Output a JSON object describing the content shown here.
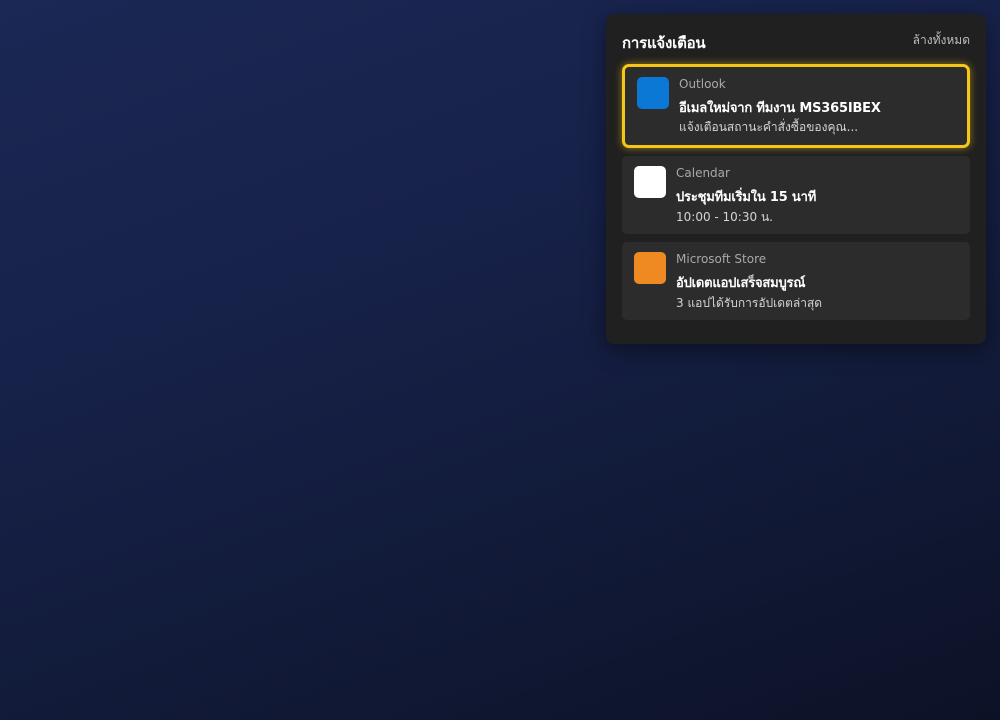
{
  "panel": {
    "title": "การแจ้งเตือน",
    "clear_all_label": "ล้างทั้งหมด"
  },
  "notifications": [
    {
      "app": "Outlook",
      "icon": "outlook-icon",
      "icon_color": "#0a78d4",
      "title": "อีเมลใหม่จาก ทีมงาน MS365IBEX",
      "body": "แจ้งเตือนสถานะคำสั่งซื้อของคุณ...",
      "focused": true
    },
    {
      "app": "Calendar",
      "icon": "calendar-icon",
      "icon_color": "#ffffff",
      "title": "ประชุมทีมเริ่มใน 15 นาที",
      "body": "10:00 - 10:30 น."
    },
    {
      "app": "Microsoft Store",
      "icon": "store-icon",
      "icon_color": "#ee8a21",
      "title": "อัปเดตแอปเสร็จสมบูรณ์",
      "body": "3 แอปได้รับการอัปเดตล่าสุด"
    }
  ],
  "colors": {
    "focus_ring": "#f5c518",
    "panel_bg": "#202020",
    "card_bg": "#2c2c2c"
  }
}
